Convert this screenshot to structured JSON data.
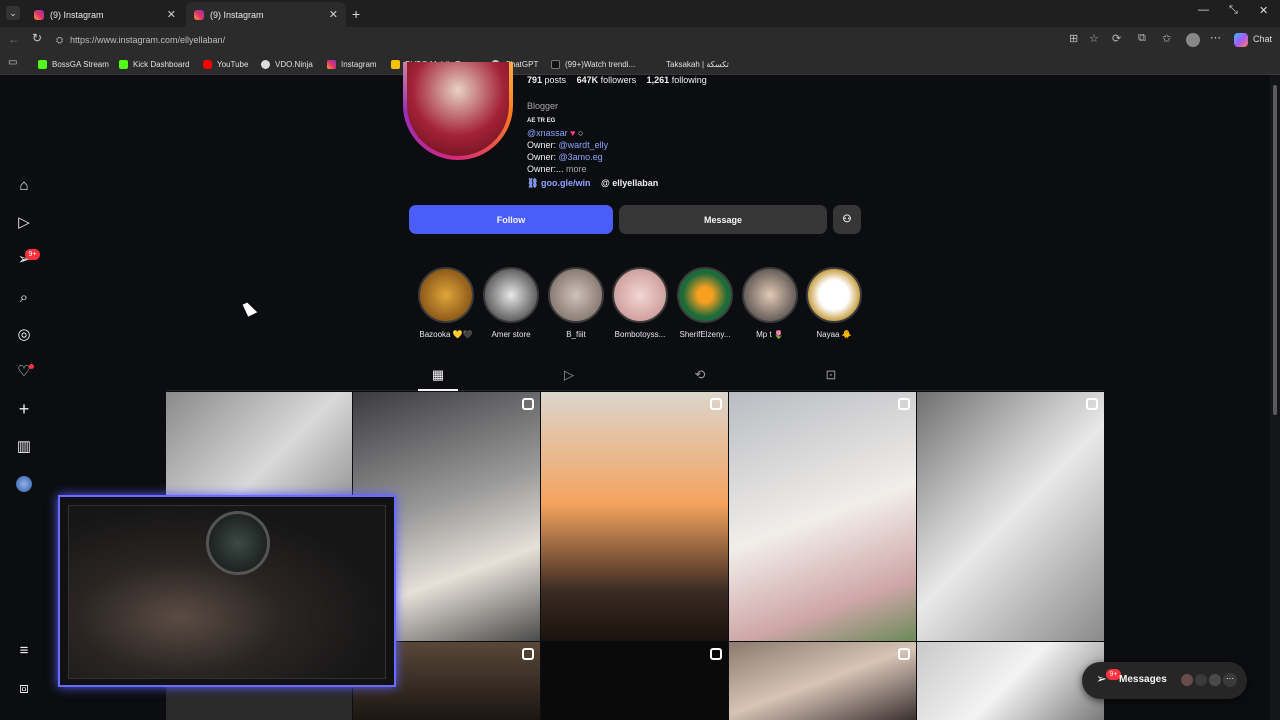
{
  "tabs": [
    {
      "title": "(9) Instagram",
      "active": false
    },
    {
      "title": "(9) Instagram",
      "active": true
    }
  ],
  "address": {
    "url": "https://www.instagram.com/ellyellaban/"
  },
  "right_chat": "Chat",
  "bookmarks": [
    "BossGA Stream",
    "Kick Dashboard",
    "YouTube",
    "VDO.Ninja",
    "Instagram",
    "PUBG Mobile Top...",
    "ChatGPT",
    "(99+)Watch trendi...",
    "Taksakah | تكسكة"
  ],
  "left_nav": {
    "icons": [
      "home-icon",
      "reels-icon",
      "inbox-icon",
      "search-icon",
      "explore-icon",
      "notifications-icon",
      "create-icon",
      "dashboard-icon",
      "profile-icon",
      "menu-icon",
      "threads-icon"
    ],
    "inbox_badge": "9+"
  },
  "profile": {
    "stats": {
      "posts": "791",
      "posts_label": "posts",
      "followers": "647K",
      "followers_label": "followers",
      "following": "1,261",
      "following_label": "following"
    },
    "category": "Blogger",
    "flags_line": "AE TR EG",
    "mention1": "@xnassar",
    "owner1_label": "Owner:",
    "owner1": "@wardt_elly",
    "owner2_label": "Owner:",
    "owner2": "@3amo.eg",
    "owner3": "Owner:...",
    "more": "more",
    "link": "goo.gle/win",
    "threads": "ellyellaban"
  },
  "buttons": {
    "follow": "Follow",
    "message": "Message"
  },
  "stories": [
    {
      "label": "Bazooka 💛🖤"
    },
    {
      "label": "Amer store"
    },
    {
      "label": "B_fiiit"
    },
    {
      "label": "Bombotoyss..."
    },
    {
      "label": "SherifElzeny..."
    },
    {
      "label": "Mp t 🌷"
    },
    {
      "label": "Nayaa 🐥"
    }
  ],
  "messages_pill": {
    "label": "Messages",
    "badge": "9+"
  },
  "colors": {
    "follow": "#4a5df9",
    "message": "#363636",
    "accent_link": "#8ea4ff",
    "badge": "#ff3040"
  }
}
